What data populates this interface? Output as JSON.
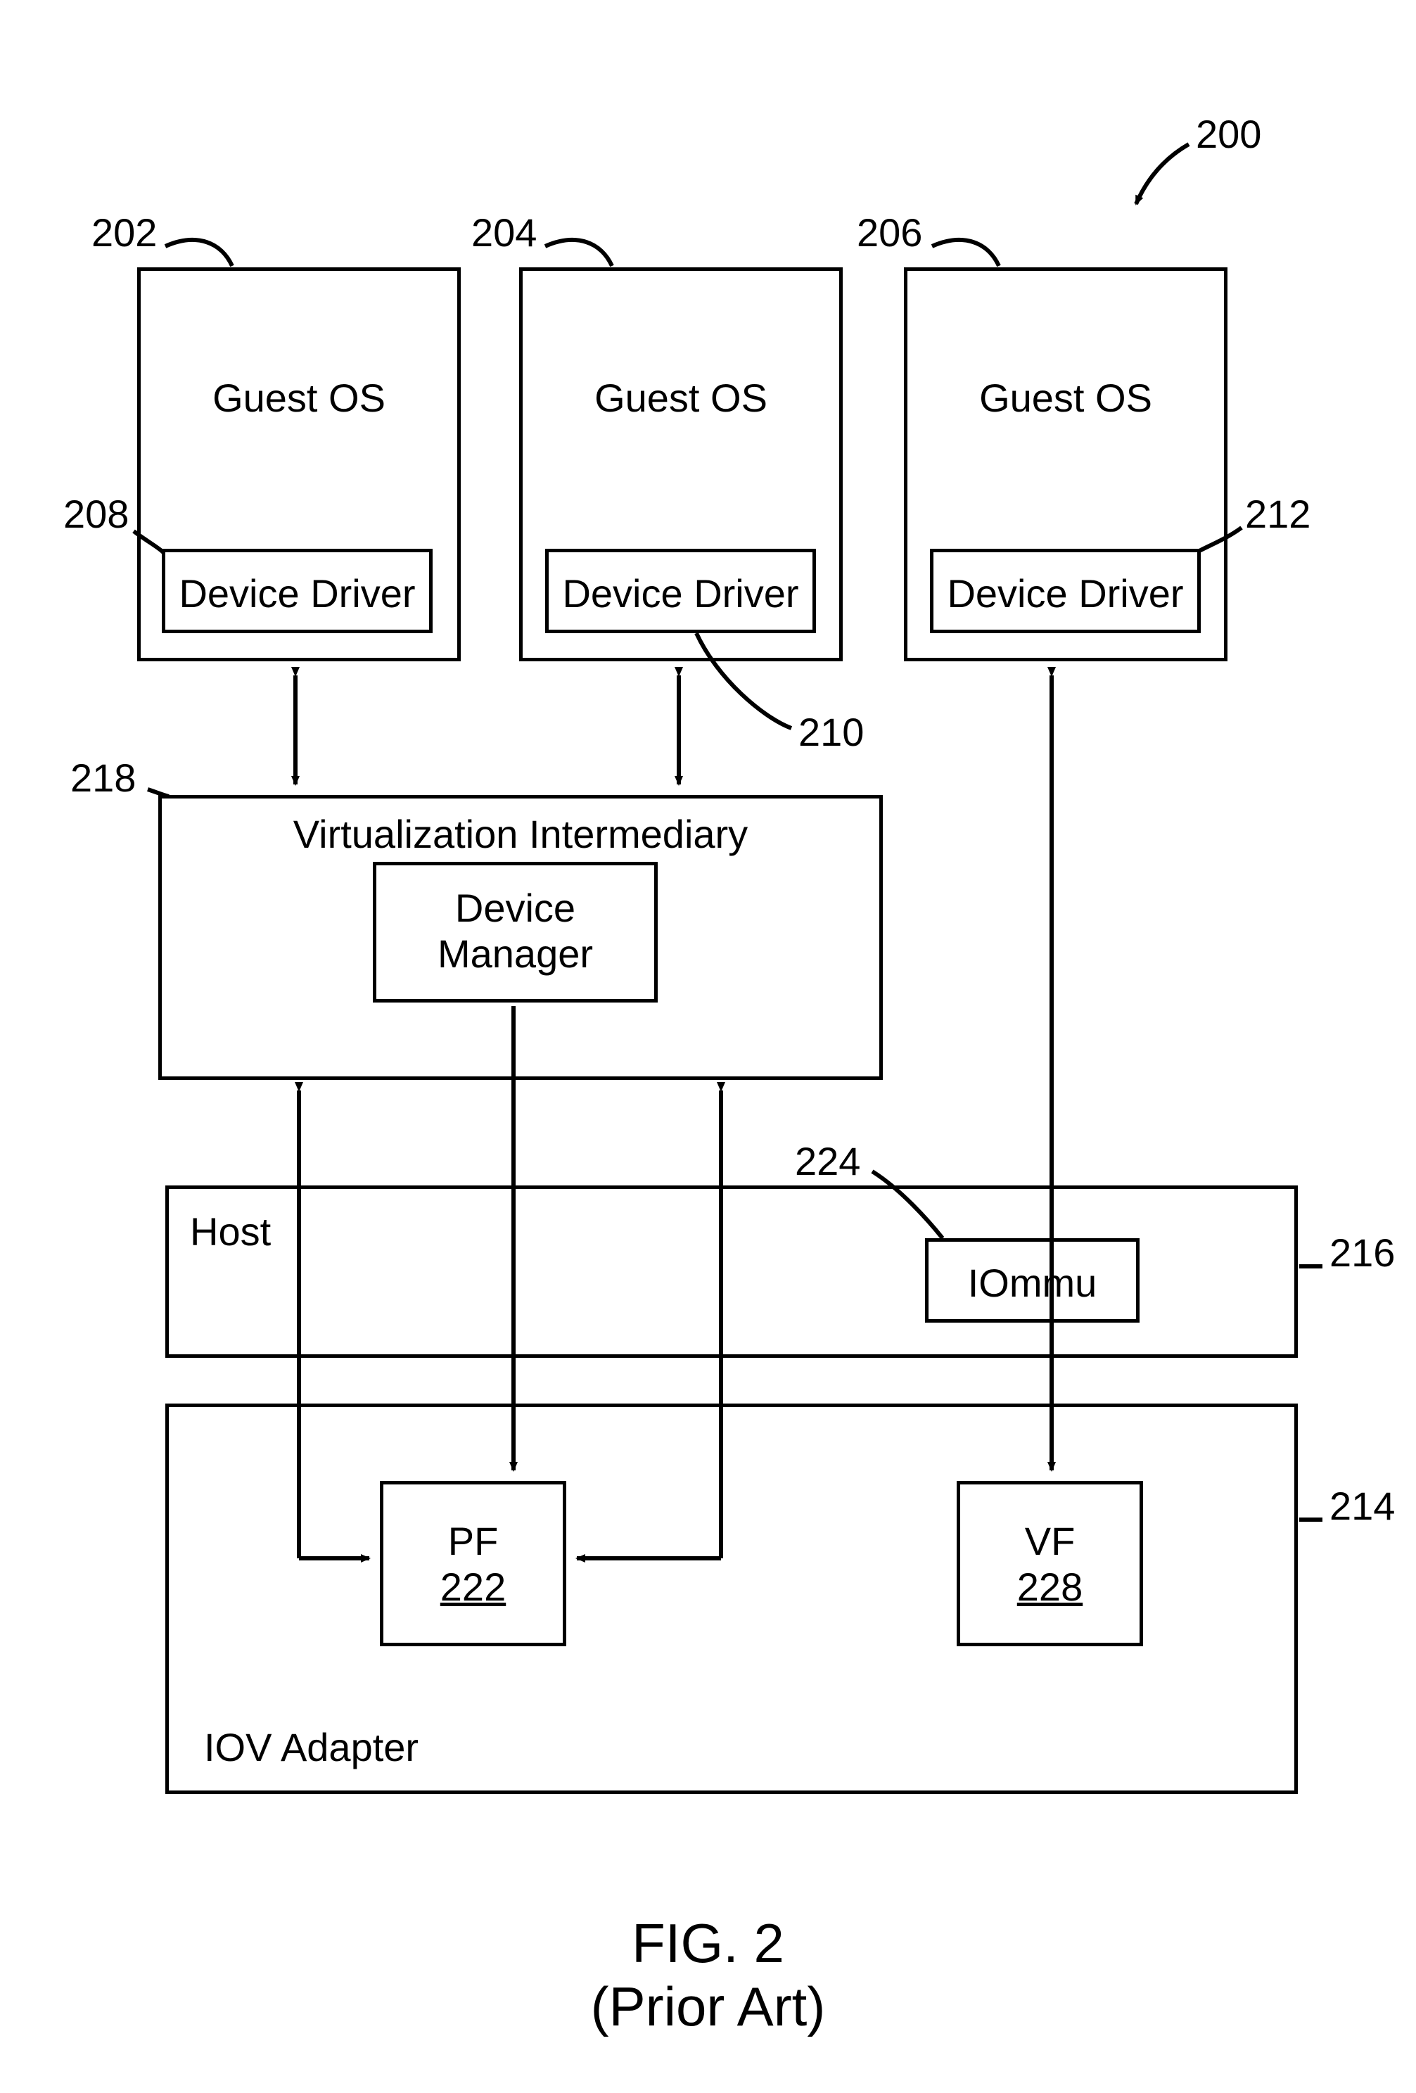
{
  "refs": {
    "r200": "200",
    "r202": "202",
    "r204": "204",
    "r206": "206",
    "r208": "208",
    "r210": "210",
    "r212": "212",
    "r214": "214",
    "r216": "216",
    "r218": "218",
    "r224": "224"
  },
  "blocks": {
    "guest_os_1": "Guest OS",
    "guest_os_2": "Guest OS",
    "guest_os_3": "Guest OS",
    "device_driver_1": "Device Driver",
    "device_driver_2": "Device Driver",
    "device_driver_3": "Device Driver",
    "vi_title": "Virtualization Intermediary",
    "device_manager_l1": "Device",
    "device_manager_l2": "Manager",
    "host": "Host",
    "iommu": "IOmmu",
    "iov_adapter": "IOV Adapter",
    "pf_label": "PF",
    "pf_num": "222",
    "vf_label": "VF",
    "vf_num": "228"
  },
  "figure": {
    "line1": "FIG. 2",
    "line2": "(Prior Art)"
  }
}
